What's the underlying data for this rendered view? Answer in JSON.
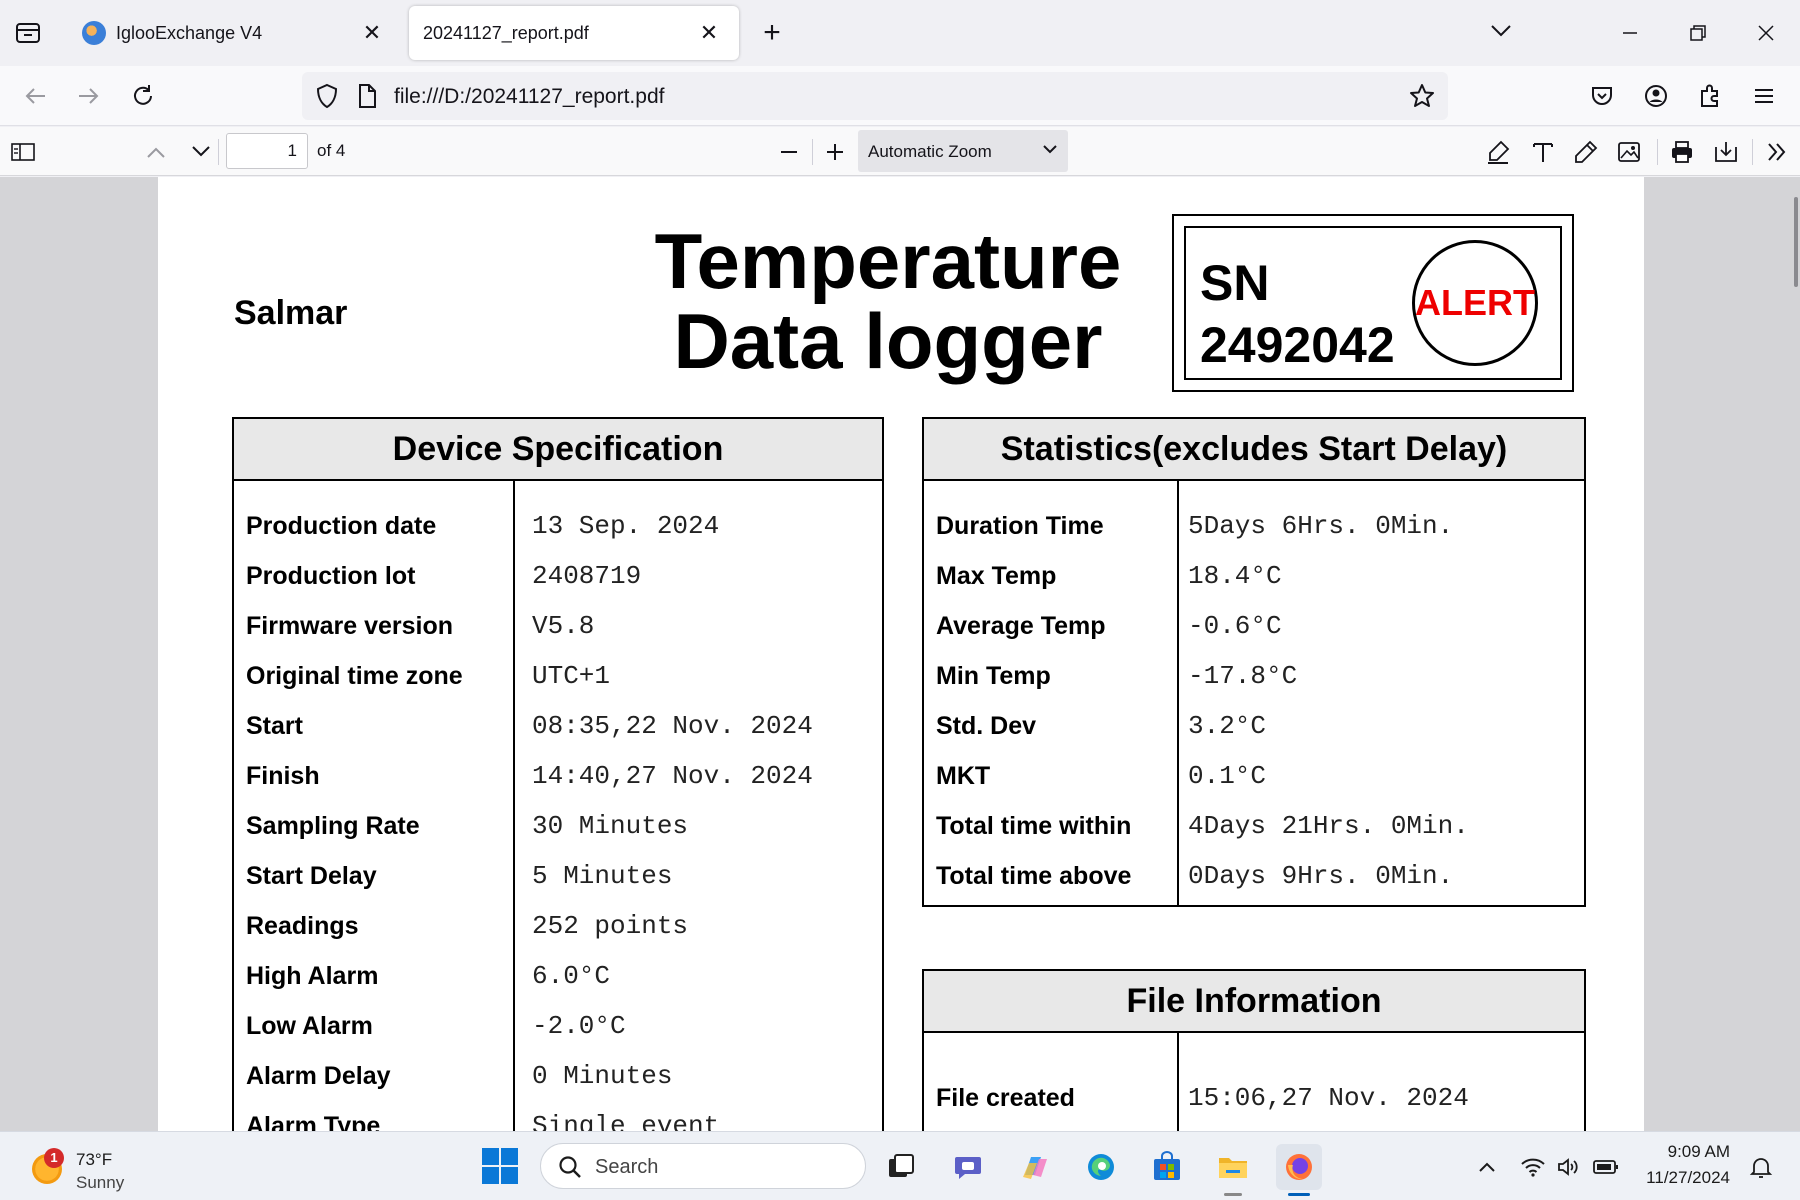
{
  "browser": {
    "tabs": [
      {
        "title": "IglooExchange V4",
        "active": false
      },
      {
        "title": "20241127_report.pdf",
        "active": true
      }
    ],
    "url": "file:///D:/20241127_report.pdf"
  },
  "pdf_toolbar": {
    "page_number": "1",
    "page_count_label": "of 4",
    "zoom": "Automatic Zoom"
  },
  "document": {
    "company": "Salmar",
    "title_line1": "Temperature",
    "title_line2": "Data logger",
    "sn_label": "SN",
    "sn_number": "2492042",
    "alert": "ALERT",
    "alert_color": "#ee0000",
    "device_spec": {
      "heading": "Device Specification",
      "rows": [
        {
          "label": "Production date",
          "value": "13 Sep. 2024"
        },
        {
          "label": "Production lot",
          "value": "2408719"
        },
        {
          "label": "Firmware version",
          "value": "V5.8"
        },
        {
          "label": "Original time zone",
          "value": "UTC+1"
        },
        {
          "label": "Start",
          "value": "08:35,22 Nov. 2024"
        },
        {
          "label": "Finish",
          "value": "14:40,27 Nov. 2024"
        },
        {
          "label": "Sampling Rate",
          "value": "30 Minutes"
        },
        {
          "label": "Start Delay",
          "value": "5 Minutes"
        },
        {
          "label": "Readings",
          "value": "252 points"
        },
        {
          "label": "High Alarm",
          "value": "6.0°C"
        },
        {
          "label": "Low Alarm",
          "value": "-2.0°C"
        },
        {
          "label": "Alarm Delay",
          "value": "0 Minutes"
        },
        {
          "label": "Alarm Type",
          "value": "Single event"
        }
      ]
    },
    "statistics": {
      "heading": "Statistics(excludes Start Delay)",
      "rows": [
        {
          "label": "Duration Time",
          "value": "5Days 6Hrs. 0Min."
        },
        {
          "label": "Max Temp",
          "value": "18.4°C"
        },
        {
          "label": "Average Temp",
          "value": "-0.6°C"
        },
        {
          "label": "Min Temp",
          "value": "-17.8°C"
        },
        {
          "label": "Std. Dev",
          "value": "3.2°C"
        },
        {
          "label": "MKT",
          "value": "0.1°C"
        },
        {
          "label": "Total time within",
          "value": "4Days 21Hrs. 0Min."
        },
        {
          "label": "Total time above",
          "value": "0Days 9Hrs. 0Min."
        }
      ]
    },
    "file_info": {
      "heading": "File Information",
      "rows": [
        {
          "label": "File created",
          "value": "15:06,27 Nov. 2024"
        }
      ]
    }
  },
  "taskbar": {
    "weather_temp": "73°F",
    "weather_condition": "Sunny",
    "weather_badge": "1",
    "search_label": "Search",
    "time": "9:09 AM",
    "date": "11/27/2024"
  }
}
